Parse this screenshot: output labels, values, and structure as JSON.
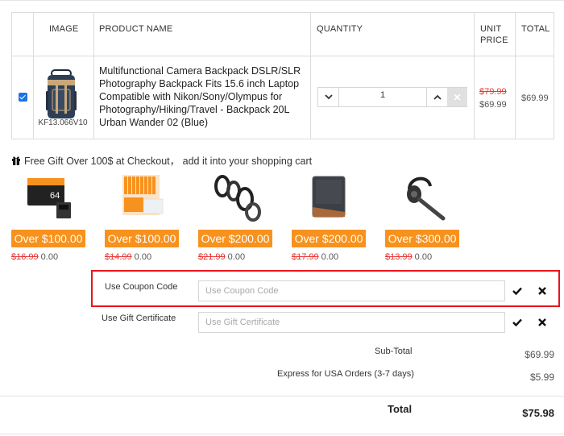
{
  "table": {
    "headers": {
      "image": "IMAGE",
      "product_name": "PRODUCT NAME",
      "quantity": "QUANTITY",
      "unit_price_1": "UNIT",
      "unit_price_2": "PRICE",
      "total": "TOTAL"
    },
    "row": {
      "checked": true,
      "sku": "KF13.066V10",
      "product_name": "Multifunctional Camera Backpack DSLR/SLR Photography Backpack Fits 15.6 inch Laptop Compatible with Nikon/Sony/Olympus for Photography/Hiking/Travel - Backpack 20L Urban Wander 02 (Blue)",
      "quantity": "1",
      "old_price": "$79.99",
      "unit_price": "$69.99",
      "total": "$69.99"
    }
  },
  "free_gift": {
    "message": "Free Gift Over 100$ at Checkout， add it into your shopping cart",
    "items": [
      {
        "badge": "Over $100.00",
        "original": "$16.99",
        "price": "0.00",
        "icon": "memory-card-icon"
      },
      {
        "badge": "Over $100.00",
        "original": "$14.99",
        "price": "0.00",
        "icon": "cleaning-kit-icon"
      },
      {
        "badge": "Over $200.00",
        "original": "$21.99",
        "price": "0.00",
        "icon": "step-rings-icon"
      },
      {
        "badge": "Over $200.00",
        "original": "$17.99",
        "price": "0.00",
        "icon": "lens-pouch-icon"
      },
      {
        "badge": "Over $300.00",
        "original": "$13.99",
        "price": "0.00",
        "icon": "bluetooth-headset-icon"
      }
    ]
  },
  "coupon": {
    "label": "Use Coupon Code",
    "placeholder": "Use Coupon Code"
  },
  "gift_certificate": {
    "label": "Use Gift Certificate",
    "placeholder": "Use Gift Certificate"
  },
  "summary": {
    "subtotal_label": "Sub-Total",
    "subtotal_value": "$69.99",
    "shipping_label": "Express for USA Orders (3-7 days)",
    "shipping_value": "$5.99",
    "total_label": "Total",
    "total_value": "$75.98"
  },
  "colors": {
    "accent_orange": "#f7921e",
    "strike_red": "#e53935",
    "highlight_red": "#e8151b",
    "checkbox_blue": "#1a73e8"
  }
}
